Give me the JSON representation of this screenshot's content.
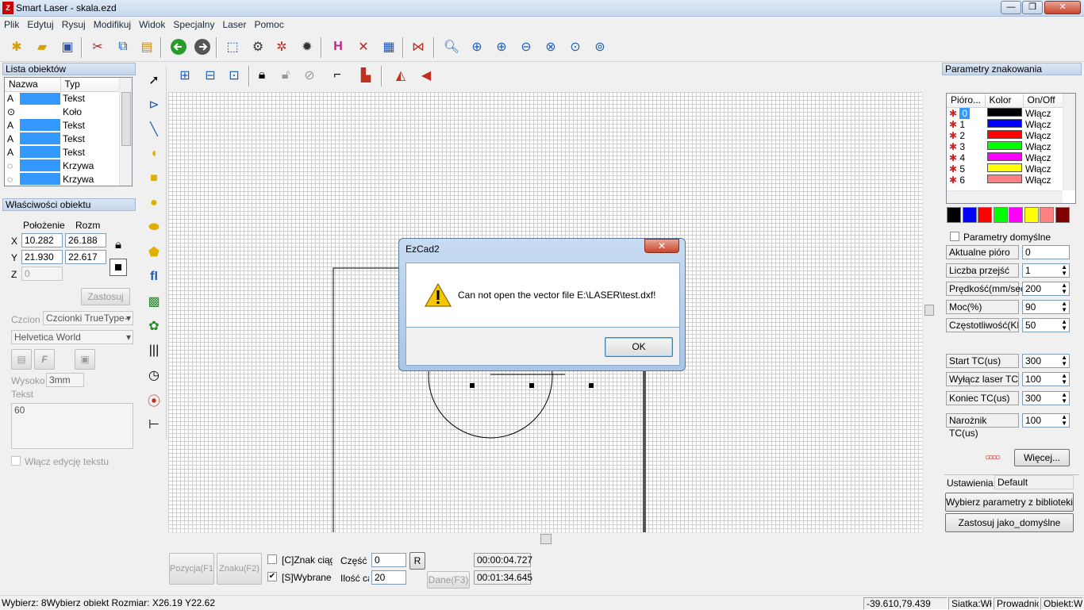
{
  "window": {
    "title": "Smart Laser - skala.ezd",
    "logo_text": "Z",
    "min": "—",
    "max": "❐",
    "close": "✕"
  },
  "menu": [
    "Plik",
    "Edytuj",
    "Rysuj",
    "Modifikuj",
    "Widok",
    "Specjalny",
    "Laser",
    "Pomoc"
  ],
  "object_list": {
    "title": "Lista obiektów",
    "columns": [
      "Nazwa",
      "Typ"
    ],
    "rows": [
      {
        "icon": "A",
        "type": "Tekst",
        "selected": true
      },
      {
        "icon": "⊙",
        "type": "Koło",
        "selected": false
      },
      {
        "icon": "A",
        "type": "Tekst",
        "selected": true
      },
      {
        "icon": "A",
        "type": "Tekst",
        "selected": true
      },
      {
        "icon": "A",
        "type": "Tekst",
        "selected": true
      },
      {
        "icon": "◌",
        "type": "Krzywa",
        "selected": true
      },
      {
        "icon": "◌",
        "type": "Krzywa",
        "selected": true
      }
    ]
  },
  "properties": {
    "title": "Właściwości obiektu",
    "col_pos": "Położenie",
    "col_size": "Rozm",
    "x_label": "X",
    "y_label": "Y",
    "z_label": "Z",
    "x_pos": "10.282",
    "x_size": "26.188",
    "y_pos": "21.930",
    "y_size": "22.617",
    "z_pos": "0",
    "apply": "Zastosuj",
    "font_label": "Czcion",
    "font_type": "Czcionki TrueType-",
    "font_name": "Helvetica World",
    "height_label": "Wysoko",
    "height_value": "3mm",
    "text_label": "Tekst",
    "text_value": "60",
    "edit_text_label": "Włącz edycję tekstu"
  },
  "bottom": {
    "pos_btn": "Pozycja(F1",
    "mark_btn": "Znaku(F2)",
    "continuous_label": "[C]Znak ciągł",
    "selected_label": "[S]Wybrane",
    "part_label": "Część",
    "part_value": "0",
    "count_label": "Ilość ca",
    "count_value": "20",
    "r_btn": "R",
    "data_btn": "Dane(F3)",
    "time1": "00:00:04.727",
    "time2": "00:01:34.645"
  },
  "marking": {
    "title": "Parametry znakowania",
    "columns": [
      "Pióro...",
      "Kolor",
      "On/Off"
    ],
    "pens": [
      {
        "num": "0",
        "color": "#000000",
        "state": "Włącz"
      },
      {
        "num": "1",
        "color": "#0000ff",
        "state": "Włącz"
      },
      {
        "num": "2",
        "color": "#ff0000",
        "state": "Włącz"
      },
      {
        "num": "3",
        "color": "#00ff00",
        "state": "Włącz"
      },
      {
        "num": "4",
        "color": "#ff00ff",
        "state": "Włącz"
      },
      {
        "num": "5",
        "color": "#ffff00",
        "state": "Włącz"
      },
      {
        "num": "6",
        "color": "#ff8080",
        "state": "Włącz"
      }
    ],
    "palette": [
      "#000000",
      "#0000ff",
      "#ff0000",
      "#00ff00",
      "#ff00ff",
      "#ffff00",
      "#ff8080",
      "#800000"
    ],
    "default_params": "Parametry domyślne",
    "current_pen_label": "Aktualne pióro",
    "current_pen": "0",
    "passes_label": "Liczba przejść",
    "passes": "1",
    "speed_label": "Prędkość(mm/sec)",
    "speed": "200",
    "power_label": "Moc(%)",
    "power": "90",
    "freq_label": "Częstotliwość(KHz)",
    "freq": "50",
    "start_tc_label": "Start TC(us)",
    "start_tc": "300",
    "laser_off_tc_label": "Wyłącz laser TC(u",
    "laser_off_tc": "100",
    "end_tc_label": "Koniec TC(us)",
    "end_tc": "300",
    "corner_tc_label": "Narożnik TC(us)",
    "corner_tc": "100",
    "more": "Więcej...",
    "settings_label": "Ustawienia:",
    "settings_value": "Default",
    "library_btn": "Wybierz parametry z biblioteki",
    "default_btn": "Zastosuj jako_domyślne"
  },
  "dialog": {
    "title": "EzCad2",
    "message": "Can not open the vector file E:\\LASER\\test.dxf!",
    "ok": "OK"
  },
  "status": {
    "left": "Wybierz: 8Wybierz obiekt Rozmiar: X26.19 Y22.62",
    "coords": "-39.610,79.439",
    "grid": "Siatka:Włą",
    "guide": "Prowadnic",
    "object": "Obiekt:Wł"
  }
}
